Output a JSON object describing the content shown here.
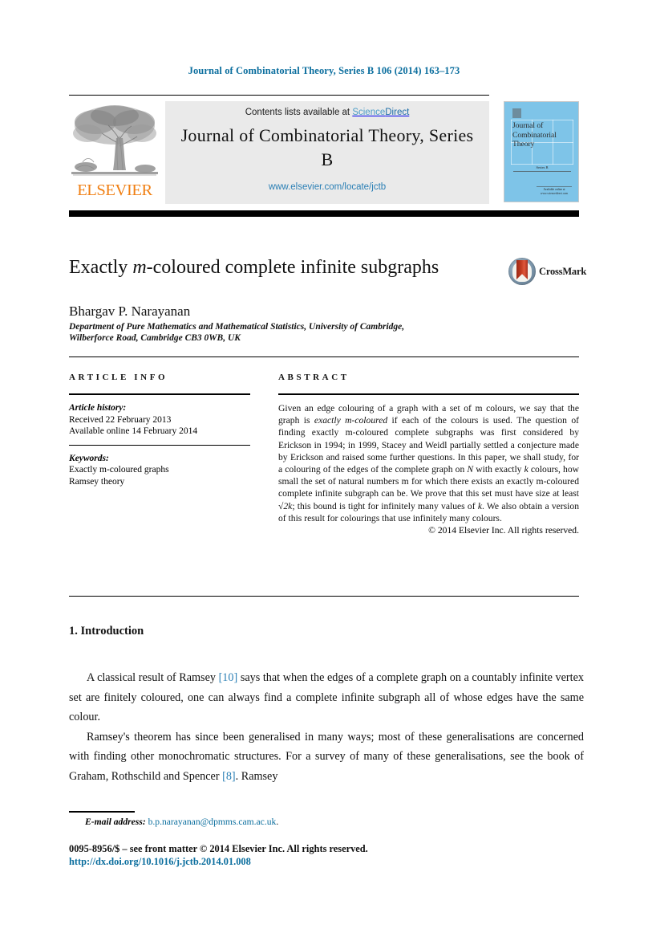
{
  "running_head": "Journal of Combinatorial Theory, Series B 106 (2014) 163–173",
  "masthead": {
    "contents_prefix": "Contents lists available at ",
    "sciencedirect_a": "Science",
    "sciencedirect_b": "Direct",
    "journal_title": "Journal of Combinatorial Theory, Series B",
    "journal_url": "www.elsevier.com/locate/jctb",
    "publisher_logo_text": "ELSEVIER",
    "cover": {
      "title": "Journal of Combinatorial Theory",
      "volume_label": "Series B",
      "footer_text": "Available online at www.sciencedirect.com"
    }
  },
  "article": {
    "title_pre": "Exactly ",
    "title_italic": "m",
    "title_post": "-coloured complete infinite subgraphs",
    "crossmark_label": "CrossMark",
    "author": "Bhargav P. Narayanan",
    "affiliation": "Department of Pure Mathematics and Mathematical Statistics, University of Cambridge, Wilberforce Road, Cambridge CB3 0WB, UK"
  },
  "info": {
    "heading": "ARTICLE INFO",
    "history_label": "Article history:",
    "history_lines": [
      "Received 22 February 2013",
      "Available online 14 February 2014"
    ],
    "keywords_label": "Keywords:",
    "keywords": [
      "Exactly m-coloured graphs",
      "Ramsey theory"
    ]
  },
  "abstract": {
    "heading": "ABSTRACT",
    "part1": "Given an edge colouring of a graph with a set of m colours, we say that the graph is ",
    "emph1": "exactly m-coloured",
    "part2": " if each of the colours is used. The question of finding exactly m-coloured complete subgraphs was first considered by Erickson in 1994; in 1999, Stacey and Weidl partially settled a conjecture made by Erickson and raised some further questions. In this paper, we shall study, for a colouring of the edges of the complete graph on ",
    "emph2": "N",
    "part3": " with exactly ",
    "emph3": "k",
    "part4": " colours, how small the set of natural numbers m for which there exists an exactly m-coloured complete infinite subgraph can be. We prove that this set must have size at least ",
    "emph4": "√2k",
    "part5": "; this bound is tight for infinitely many values of ",
    "emph5": "k",
    "part6": ". We also obtain a version of this result for colourings that use infinitely many colours.",
    "copyright": "© 2014 Elsevier Inc. All rights reserved."
  },
  "body": {
    "section_number_title": "1. Introduction",
    "para1_a": "A classical result of Ramsey ",
    "para1_cite": "[10]",
    "para1_b": " says that when the edges of a complete graph on a countably infinite vertex set are finitely coloured, one can always find a complete infinite subgraph all of whose edges have the same colour.",
    "para2_a": "Ramsey's theorem has since been generalised in many ways; most of these generalisations are concerned with finding other monochromatic structures. For a survey of many of these generalisations, see the book of Graham, Rothschild and Spencer ",
    "para2_cite": "[8]",
    "para2_b": ". Ramsey"
  },
  "footer": {
    "email_label": "E-mail address:",
    "email_address": "b.p.narayanan@dpmms.cam.ac.uk",
    "email_period": ".",
    "issn_line": "0095-8956/$ – see front matter © 2014 Elsevier Inc. All rights reserved.",
    "doi_line": "http://dx.doi.org/10.1016/j.jctb.2014.01.008"
  },
  "colors": {
    "link_blue": "#0b6e9e",
    "accent_blue": "#2a7fb5",
    "elsevier_orange": "#f07f13",
    "cover_blue": "#7ec4e8",
    "panel_gray": "#eaeaea"
  }
}
